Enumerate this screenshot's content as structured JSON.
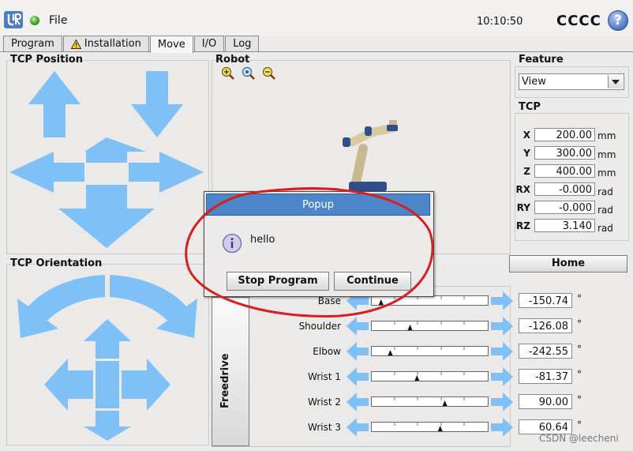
{
  "topbar": {
    "menu_label": "File",
    "clock": "10:10:50",
    "robot_name": "CCCC",
    "help_label": "?"
  },
  "tabs": [
    "Program",
    "Installation",
    "Move",
    "I/O",
    "Log"
  ],
  "active_tab": "Move",
  "tcp_position": {
    "title": "TCP Position"
  },
  "tcp_orientation": {
    "title": "TCP Orientation"
  },
  "robot_view": {
    "title": "Robot"
  },
  "feature": {
    "title": "Feature",
    "selected": "View"
  },
  "tcp": {
    "title": "TCP",
    "rows": [
      {
        "label": "X",
        "value": "200.00",
        "unit": "mm"
      },
      {
        "label": "Y",
        "value": "300.00",
        "unit": "mm"
      },
      {
        "label": "Z",
        "value": "400.00",
        "unit": "mm"
      },
      {
        "label": "RX",
        "value": "-0.000",
        "unit": "rad"
      },
      {
        "label": "RY",
        "value": "-0.000",
        "unit": "rad"
      },
      {
        "label": "RZ",
        "value": "3.140",
        "unit": "rad"
      }
    ]
  },
  "home_label": "Home",
  "freedrive_label": "Freedrive",
  "joints": [
    {
      "label": "Base",
      "value": "-150.74",
      "unit": "°",
      "position": 0.08
    },
    {
      "label": "Shoulder",
      "value": "-126.08",
      "unit": "°",
      "position": 0.33
    },
    {
      "label": "Elbow",
      "value": "-242.55",
      "unit": "°",
      "position": 0.16
    },
    {
      "label": "Wrist 1",
      "value": "-81.37",
      "unit": "°",
      "position": 0.39
    },
    {
      "label": "Wrist 2",
      "value": "90.00",
      "unit": "°",
      "position": 0.63
    },
    {
      "label": "Wrist 3",
      "value": "60.64",
      "unit": "°",
      "position": 0.59
    }
  ],
  "popup": {
    "title": "Popup",
    "message": "hello",
    "stop_label": "Stop Program",
    "continue_label": "Continue"
  },
  "watermark": "CSDN @leecheni",
  "colors": {
    "arrow": "#7fc0f7",
    "popup_header": "#4d86c9",
    "annotation": "#d81e1e"
  }
}
